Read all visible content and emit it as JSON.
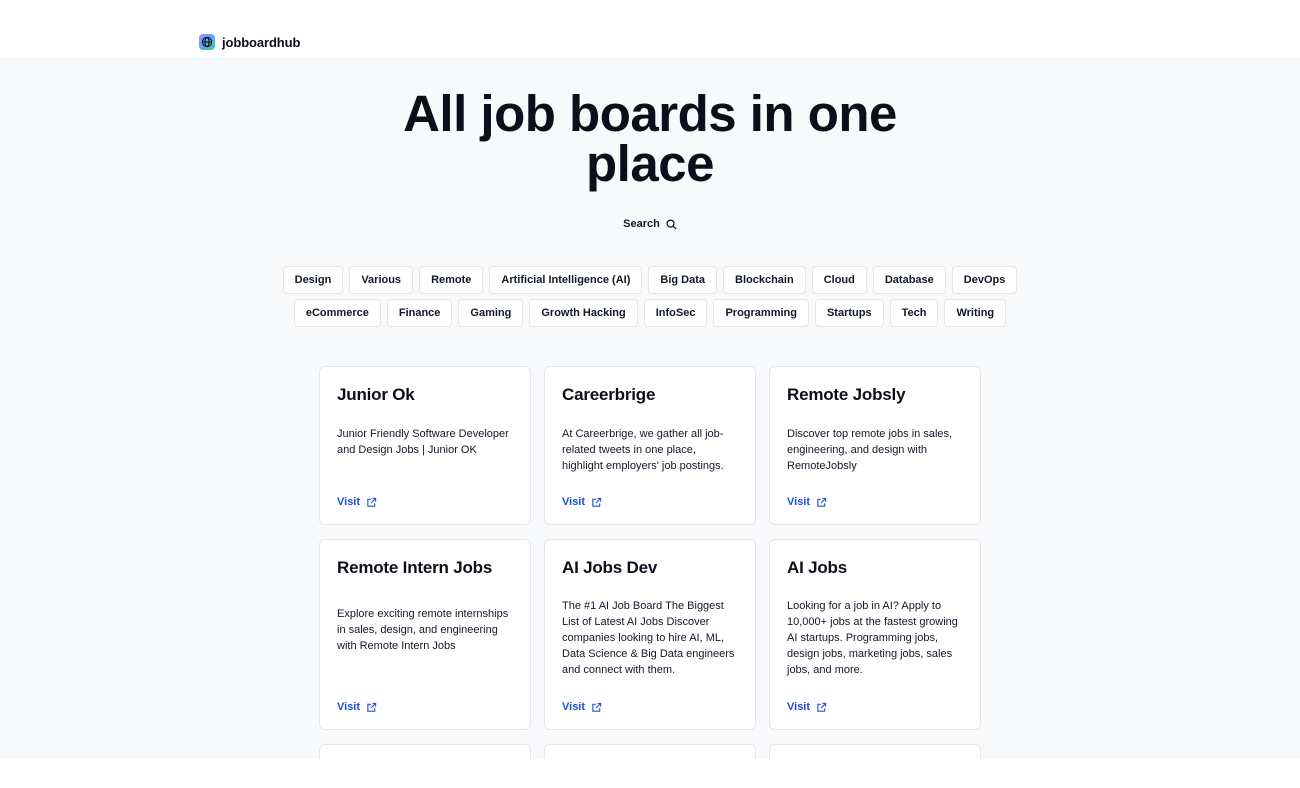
{
  "header": {
    "brand_name": "jobboardhub",
    "logo_icon": "globe-icon"
  },
  "hero": {
    "title_line1": "All job boards in one",
    "title_line2": "place",
    "search_label": "Search"
  },
  "categories": {
    "row1": [
      "Design",
      "Various",
      "Remote",
      "Artificial Intelligence (AI)",
      "Big Data",
      "Blockchain",
      "Cloud",
      "Database",
      "DevOps"
    ],
    "row2": [
      "eCommerce",
      "Finance",
      "Gaming",
      "Growth Hacking",
      "InfoSec",
      "Programming",
      "Startups",
      "Tech",
      "Writing"
    ]
  },
  "cards": [
    {
      "title": "Junior Ok",
      "description": "Junior Friendly Software Developer and Design Jobs | Junior OK",
      "link_label": "Visit"
    },
    {
      "title": "Careerbrige",
      "description": "At Careerbrige, we gather all job-related tweets in one place, highlight employers' job postings.",
      "link_label": "Visit"
    },
    {
      "title": "Remote Jobsly",
      "description": "Discover top remote jobs in sales, engineering, and design with RemoteJobsly",
      "link_label": "Visit"
    },
    {
      "title": "Remote Intern Jobs",
      "description": "Explore exciting remote internships in sales, design, and engineering with Remote Intern Jobs",
      "link_label": "Visit"
    },
    {
      "title": "AI Jobs Dev",
      "description": "The #1 AI Job Board The Biggest List of Latest AI Jobs Discover companies looking to hire AI, ML, Data Science & Big Data engineers and connect with them.",
      "link_label": "Visit"
    },
    {
      "title": "AI Jobs",
      "description": "Looking for a job in AI? Apply to 10,000+ jobs at the fastest growing AI startups. Programming jobs, design jobs, marketing jobs, sales jobs, and more.",
      "link_label": "Visit"
    }
  ],
  "colors": {
    "accent_link": "#1d4ed8",
    "page_bg": "#f8f9fb",
    "text": "#0b0f19"
  }
}
